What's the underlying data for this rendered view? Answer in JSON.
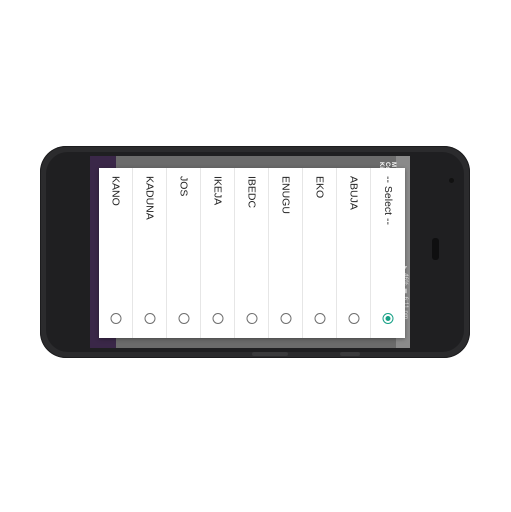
{
  "status_bar": {
    "time": "6:11 pm",
    "battery": "46%"
  },
  "background_text": [
    "Ki",
    "Co",
    "M"
  ],
  "dialog": {
    "options": [
      {
        "label": "-- Select --",
        "selected": true
      },
      {
        "label": "ABUJA",
        "selected": false
      },
      {
        "label": "EKO",
        "selected": false
      },
      {
        "label": "ENUGU",
        "selected": false
      },
      {
        "label": "IBEDC",
        "selected": false
      },
      {
        "label": "IKEJA",
        "selected": false
      },
      {
        "label": "JOS",
        "selected": false
      },
      {
        "label": "KADUNA",
        "selected": false
      },
      {
        "label": "KANO",
        "selected": false
      }
    ]
  },
  "colors": {
    "accent": "#16a085",
    "app_bar": "#3a2748",
    "phone_body": "#2b2b2d"
  }
}
